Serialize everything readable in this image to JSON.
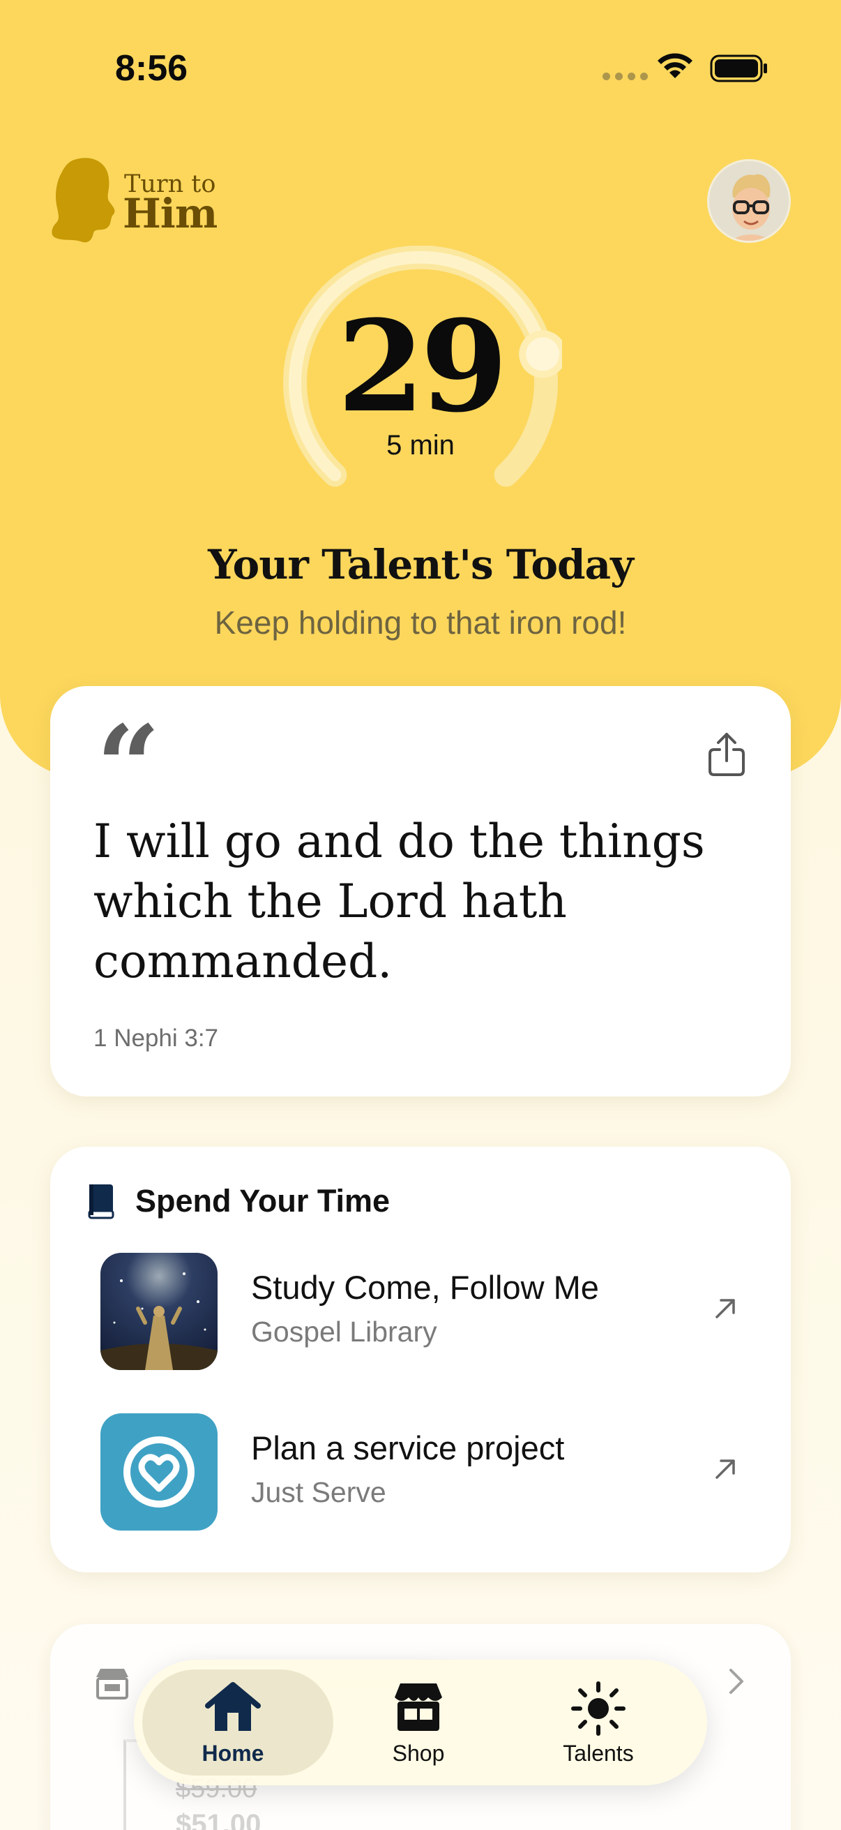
{
  "status": {
    "time": "8:56"
  },
  "logo": {
    "line1": "Turn to",
    "line2": "Him"
  },
  "progress": {
    "count": "29",
    "minutes": "5 min",
    "fraction": 0.78
  },
  "talent": {
    "title": "Your Talent's Today",
    "subtitle": "Keep holding to that iron rod!"
  },
  "quote": {
    "mark": "“",
    "text": "I will go and do the things which the Lord hath commanded.",
    "reference": "1 Nephi 3:7"
  },
  "spend_time": {
    "title": "Spend Your Time",
    "items": [
      {
        "title": "Study Come, Follow Me",
        "subtitle": "Gospel Library"
      },
      {
        "title": "Plan a service project",
        "subtitle": "Just Serve"
      }
    ]
  },
  "shop": {
    "price_old": "$59.00",
    "price_new": "$51.00"
  },
  "tabs": [
    {
      "label": "Home",
      "icon": "house-icon",
      "selected": true
    },
    {
      "label": "Shop",
      "icon": "storefront-icon",
      "selected": false
    },
    {
      "label": "Talents",
      "icon": "sun-icon",
      "selected": false
    }
  ],
  "colors": {
    "hero": "#FCD75C",
    "navy": "#102A4C",
    "justserve": "#3FA2C4",
    "logo": "#C79A06"
  }
}
